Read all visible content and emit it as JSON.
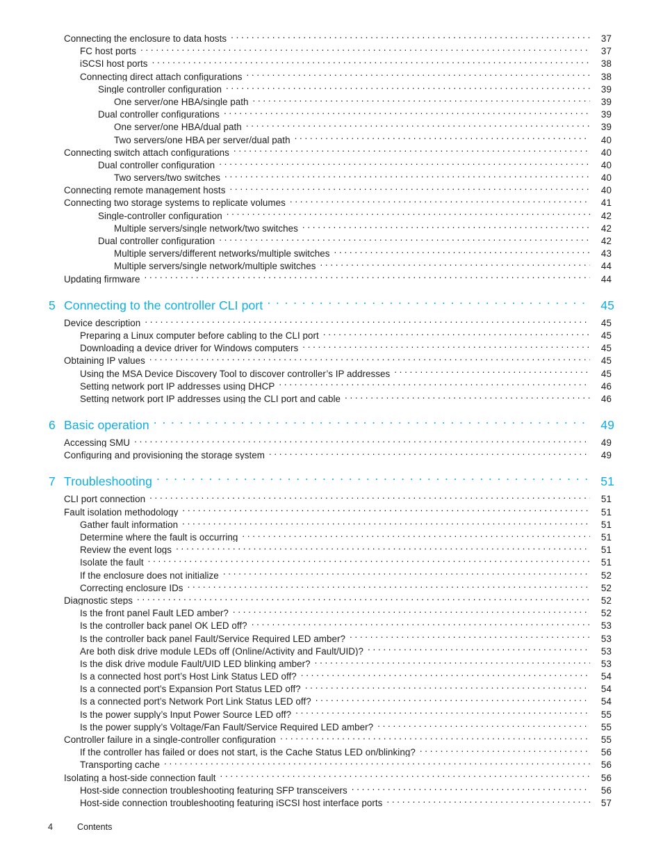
{
  "document": {
    "section_label": "Contents",
    "page_number": "4",
    "accent_color": "#0DAEE4",
    "text_color": "#1a1a1a"
  },
  "toc": {
    "entries": [
      {
        "level": 1,
        "title": "Connecting the enclosure to data hosts",
        "page": "37",
        "kind": "entry"
      },
      {
        "level": 2,
        "title": "FC host ports",
        "page": "37",
        "kind": "entry"
      },
      {
        "level": 2,
        "title": "iSCSI host ports",
        "page": "38",
        "kind": "entry"
      },
      {
        "level": 2,
        "title": "Connecting direct attach configurations",
        "page": "38",
        "kind": "entry"
      },
      {
        "level": 3,
        "title": "Single controller configuration",
        "page": "39",
        "kind": "entry"
      },
      {
        "level": 4,
        "title": "One server/one HBA/single path",
        "page": "39",
        "kind": "entry"
      },
      {
        "level": 3,
        "title": "Dual controller configurations",
        "page": "39",
        "kind": "entry"
      },
      {
        "level": 4,
        "title": "One server/one HBA/dual path",
        "page": "39",
        "kind": "entry"
      },
      {
        "level": 4,
        "title": "Two servers/one HBA per server/dual path",
        "page": "40",
        "kind": "entry"
      },
      {
        "level": 1,
        "title": "Connecting switch attach configurations",
        "page": "40",
        "kind": "entry"
      },
      {
        "level": 3,
        "title": "Dual controller configuration",
        "page": "40",
        "kind": "entry"
      },
      {
        "level": 4,
        "title": "Two servers/two switches",
        "page": "40",
        "kind": "entry"
      },
      {
        "level": 1,
        "title": "Connecting remote management hosts",
        "page": "40",
        "kind": "entry"
      },
      {
        "level": 1,
        "title": "Connecting two storage systems to replicate volumes",
        "page": "41",
        "kind": "entry"
      },
      {
        "level": 3,
        "title": "Single-controller configuration",
        "page": "42",
        "kind": "entry"
      },
      {
        "level": 4,
        "title": "Multiple servers/single network/two switches",
        "page": "42",
        "kind": "entry"
      },
      {
        "level": 3,
        "title": "Dual controller configuration",
        "page": "42",
        "kind": "entry"
      },
      {
        "level": 4,
        "title": "Multiple servers/different networks/multiple switches",
        "page": "43",
        "kind": "entry"
      },
      {
        "level": 4,
        "title": "Multiple servers/single network/multiple switches",
        "page": "44",
        "kind": "entry"
      },
      {
        "level": 1,
        "title": "Updating firmware",
        "page": "44",
        "kind": "entry"
      },
      {
        "kind": "spacer"
      },
      {
        "level": 0,
        "chapter": "5",
        "title": "Connecting to the controller CLI port",
        "page": "45",
        "kind": "chapter"
      },
      {
        "level": 1,
        "title": "Device description",
        "page": "45",
        "kind": "entry"
      },
      {
        "level": 2,
        "title": "Preparing a Linux computer before cabling to the CLI port",
        "page": "45",
        "kind": "entry"
      },
      {
        "level": 2,
        "title": "Downloading a device driver for Windows computers",
        "page": "45",
        "kind": "entry"
      },
      {
        "level": 1,
        "title": "Obtaining IP values",
        "page": "45",
        "kind": "entry"
      },
      {
        "level": 2,
        "title": "Using the MSA Device Discovery Tool to discover controller’s IP addresses",
        "page": "45",
        "kind": "entry"
      },
      {
        "level": 2,
        "title": "Setting network port IP addresses using DHCP",
        "page": "46",
        "kind": "entry"
      },
      {
        "level": 2,
        "title": "Setting network port IP addresses using the CLI port and cable",
        "page": "46",
        "kind": "entry"
      },
      {
        "kind": "spacer"
      },
      {
        "level": 0,
        "chapter": "6",
        "title": "Basic operation",
        "page": "49",
        "kind": "chapter"
      },
      {
        "level": 1,
        "title": "Accessing SMU",
        "page": "49",
        "kind": "entry"
      },
      {
        "level": 1,
        "title": "Configuring and provisioning the storage system",
        "page": "49",
        "kind": "entry"
      },
      {
        "kind": "spacer"
      },
      {
        "level": 0,
        "chapter": "7",
        "title": "Troubleshooting",
        "page": "51",
        "kind": "chapter"
      },
      {
        "level": 1,
        "title": "CLI port connection",
        "page": "51",
        "kind": "entry"
      },
      {
        "level": 1,
        "title": "Fault isolation methodology",
        "page": "51",
        "kind": "entry"
      },
      {
        "level": 2,
        "title": "Gather fault information",
        "page": "51",
        "kind": "entry"
      },
      {
        "level": 2,
        "title": "Determine where the fault is occurring",
        "page": "51",
        "kind": "entry"
      },
      {
        "level": 2,
        "title": "Review the event logs",
        "page": "51",
        "kind": "entry"
      },
      {
        "level": 2,
        "title": "Isolate the fault",
        "page": "51",
        "kind": "entry"
      },
      {
        "level": 2,
        "title": "If the enclosure does not initialize",
        "page": "52",
        "kind": "entry"
      },
      {
        "level": 2,
        "title": "Correcting enclosure IDs",
        "page": "52",
        "kind": "entry"
      },
      {
        "level": 1,
        "title": "Diagnostic steps",
        "page": "52",
        "kind": "entry"
      },
      {
        "level": 2,
        "title": "Is the front panel Fault LED amber?",
        "page": "52",
        "kind": "entry"
      },
      {
        "level": 2,
        "title": "Is the controller back panel OK LED off?",
        "page": "53",
        "kind": "entry"
      },
      {
        "level": 2,
        "title": "Is the controller back panel Fault/Service Required LED amber?",
        "page": "53",
        "kind": "entry"
      },
      {
        "level": 2,
        "title": "Are both disk drive module LEDs off (Online/Activity and Fault/UID)?",
        "page": "53",
        "kind": "entry"
      },
      {
        "level": 2,
        "title": "Is the disk drive module Fault/UID LED blinking amber?",
        "page": "53",
        "kind": "entry"
      },
      {
        "level": 2,
        "title": "Is a connected host port’s Host Link Status LED off?",
        "page": "54",
        "kind": "entry"
      },
      {
        "level": 2,
        "title": "Is a connected port’s Expansion Port Status LED off?",
        "page": "54",
        "kind": "entry"
      },
      {
        "level": 2,
        "title": "Is a connected port’s Network Port Link Status LED off?",
        "page": "54",
        "kind": "entry"
      },
      {
        "level": 2,
        "title": "Is the power supply’s Input Power Source LED off?",
        "page": "55",
        "kind": "entry"
      },
      {
        "level": 2,
        "title": "Is the power supply’s Voltage/Fan Fault/Service Required LED amber?",
        "page": "55",
        "kind": "entry"
      },
      {
        "level": 1,
        "title": "Controller failure in a single-controller configuration",
        "page": "55",
        "kind": "entry"
      },
      {
        "level": 2,
        "title": "If the controller has failed or does not start, is the Cache Status LED on/blinking?",
        "page": "56",
        "kind": "entry"
      },
      {
        "level": 2,
        "title": "Transporting cache",
        "page": "56",
        "kind": "entry"
      },
      {
        "level": 1,
        "title": "Isolating a host-side connection fault",
        "page": "56",
        "kind": "entry"
      },
      {
        "level": 2,
        "title": "Host-side connection troubleshooting featuring SFP transceivers",
        "page": "56",
        "kind": "entry"
      },
      {
        "level": 2,
        "title": "Host-side connection troubleshooting featuring iSCSI host interface ports",
        "page": "57",
        "kind": "entry"
      }
    ]
  }
}
